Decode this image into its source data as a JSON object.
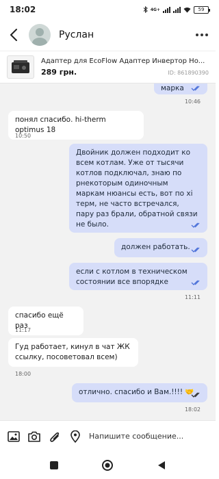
{
  "status_bar": {
    "time": "18:02",
    "network": "4G+",
    "battery": "59"
  },
  "header": {
    "contact_name": "Руслан"
  },
  "product": {
    "title": "Адаптер для EcoFlow Адаптер Инвертор Но...",
    "price": "289 грн.",
    "id": "ID: 861890390"
  },
  "messages": [
    {
      "dir": "out",
      "text": "марка",
      "time": "10:46"
    },
    {
      "dir": "in",
      "text": "понял спасибо. hi-therm optimus 18",
      "time": "10:50"
    },
    {
      "dir": "out",
      "text": "Двойник должен подходит ко всем котлам. Уже от тысячи котлов подключал, знаю по рнекоторым одиночным маркам нюансы есть, вот по хі терм, не часто встречался, пару раз брали, обратной связи не было.",
      "time": ""
    },
    {
      "dir": "out",
      "text": "должен работать.",
      "time": ""
    },
    {
      "dir": "out",
      "text": "если с котлом в техническом состоянии все впорядке",
      "time": "11:11"
    },
    {
      "dir": "in",
      "text": "спасибо ещё раз",
      "time": "11:17"
    },
    {
      "dir": "in",
      "text": "Гуд работает, кинул в чат  ЖК ссылку, посоветовал всем)",
      "time": "18:00"
    },
    {
      "dir": "out",
      "text": "отлично. спасибо и Вам.!!!! 🤝",
      "time": "18:02"
    }
  ],
  "composer": {
    "placeholder": "Напишите сообщение..."
  },
  "colors": {
    "outgoing_bubble": "#d6ddf9",
    "incoming_bubble": "#ffffff",
    "chat_bg": "#f2f2f2",
    "read_check": "#4a6fd8"
  },
  "icons": {
    "back": "arrow-left",
    "more": "three-dots",
    "product": "power-station",
    "image": "image",
    "camera": "camera",
    "attach": "paperclip",
    "location": "location-pin",
    "nav_square": "square",
    "nav_home": "circle",
    "nav_back": "triangle"
  }
}
